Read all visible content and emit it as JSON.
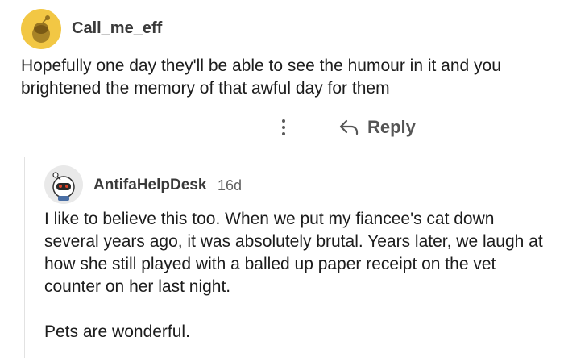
{
  "comment": {
    "username": "Call_me_eff",
    "body": "Hopefully one day they'll be able to see the humour in it and you brightened the memory of that awful day for them",
    "avatar_icon": "snoo-avatar-yellow",
    "actions": {
      "more_icon": "vertical-ellipsis-icon",
      "reply_icon": "reply-arrow-icon",
      "reply_label": "Reply"
    }
  },
  "reply": {
    "username": "AntifaHelpDesk",
    "age": "16d",
    "avatar_icon": "snoo-avatar-astronaut",
    "paragraphs": [
      "I like to believe this too. When we put my fiancee's cat down several years ago, it was absolutely brutal. Years later, we laugh at how she still played with a balled up paper receipt on the vet counter on her last night.",
      "Pets are wonderful."
    ]
  },
  "colors": {
    "avatar_yellow": "#f2c744",
    "text": "#1c1c1c",
    "muted": "#555555",
    "thread_line": "#e2e2e2"
  }
}
